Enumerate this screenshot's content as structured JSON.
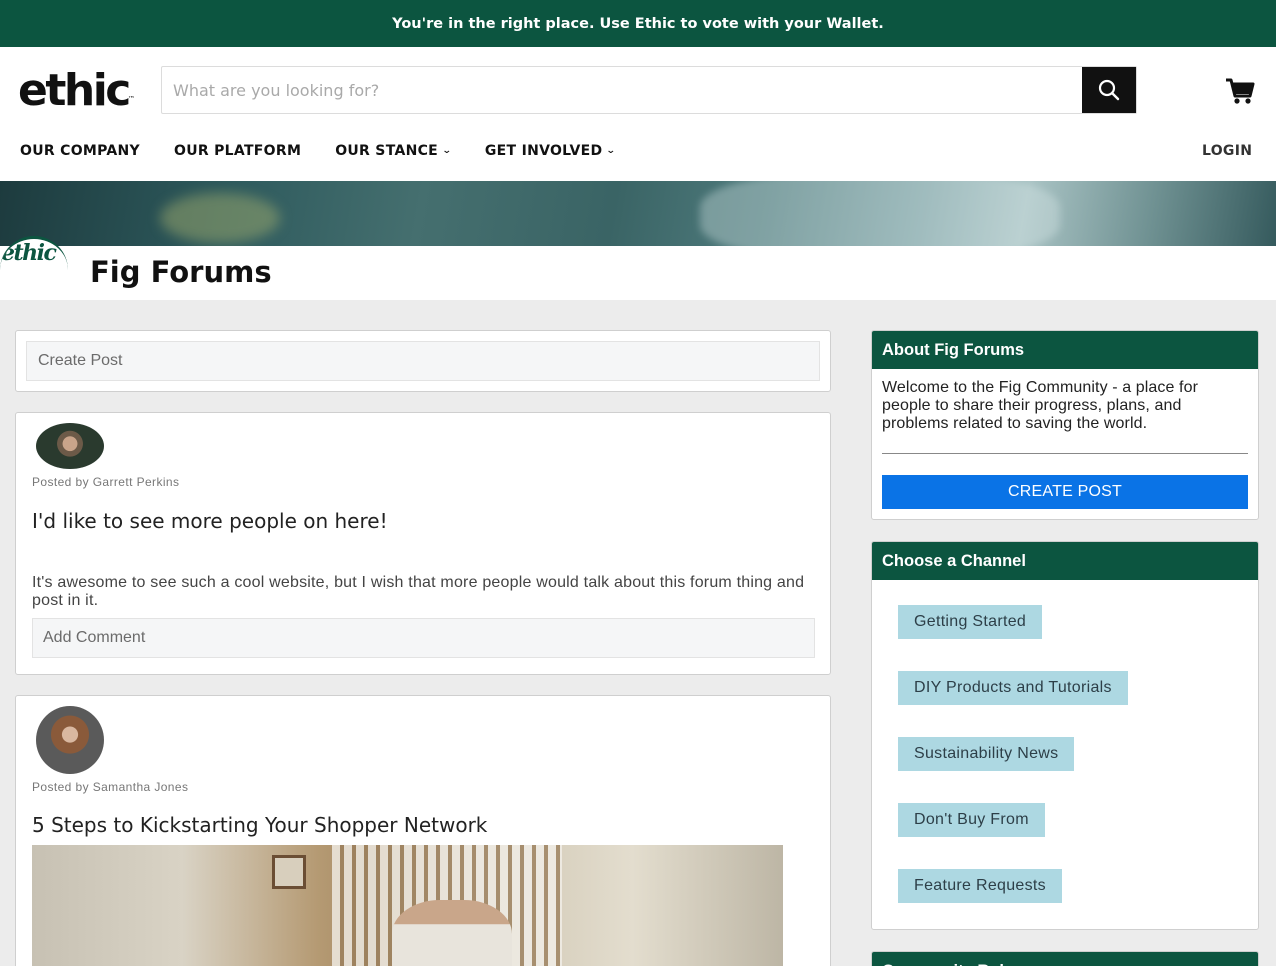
{
  "announcement": "You're in the right place. Use Ethic to vote with your Wallet.",
  "header": {
    "logo": "ethic",
    "logo_tm": "™",
    "search_placeholder": "What are you looking for?",
    "nav": [
      "OUR COMPANY",
      "OUR PLATFORM",
      "OUR STANCE",
      "GET INVOLVED"
    ],
    "login": "LOGIN"
  },
  "forum": {
    "logo": "ethic",
    "title": "Fig Forums"
  },
  "create_post_placeholder": "Create Post",
  "posts": [
    {
      "posted_by": "Posted by Garrett Perkins",
      "title": "I'd like to see more people on here!",
      "body": "It's awesome to see such a cool website, but I wish that more people would talk about this forum thing and post in it.",
      "comment_placeholder": "Add Comment"
    },
    {
      "posted_by": "Posted by Samantha Jones",
      "title": "5 Steps to Kickstarting Your Shopper Network"
    }
  ],
  "sidebar": {
    "about": {
      "heading": "About Fig Forums",
      "text": "Welcome to the Fig Community - a place for people to share their progress, plans, and problems related to saving the world.",
      "button": "CREATE POST"
    },
    "channels": {
      "heading": "Choose a Channel",
      "items": [
        "Getting Started",
        "DIY Products and Tutorials",
        "Sustainability News",
        "Don't Buy From",
        "Feature Requests"
      ]
    },
    "rules_heading": "Community Rules"
  },
  "colors": {
    "brand_green": "#0c5540",
    "button_blue": "#0a73e6",
    "chip_blue": "#add8e2"
  }
}
